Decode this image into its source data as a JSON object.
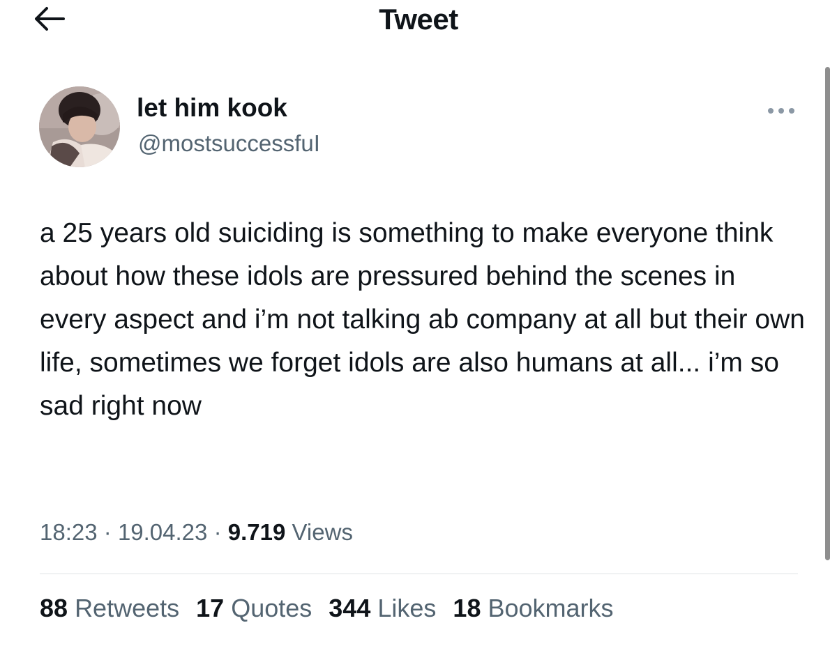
{
  "header": {
    "title": "Tweet",
    "back_icon": "arrow-left-icon"
  },
  "author": {
    "name": "let him kook",
    "handle": "@mostsuccessfuI",
    "avatar_icon": "profile-photo"
  },
  "more_icon": "more-horizontal-icon",
  "tweet": {
    "text": "a 25 years old suiciding is something to make everyone think about how these idols are pressured behind the scenes in every aspect and i’m not talking ab company at all but their own life, sometimes we forget idols are also humans at all... i’m so sad right now"
  },
  "meta": {
    "time": "18:23",
    "date": "19.04.23",
    "views_count": "9.719",
    "views_label": "Views",
    "separator": "·"
  },
  "stats": {
    "retweets": {
      "count": "88",
      "label": "Retweets"
    },
    "quotes": {
      "count": "17",
      "label": "Quotes"
    },
    "likes": {
      "count": "344",
      "label": "Likes"
    },
    "bookmarks": {
      "count": "18",
      "label": "Bookmarks"
    }
  }
}
